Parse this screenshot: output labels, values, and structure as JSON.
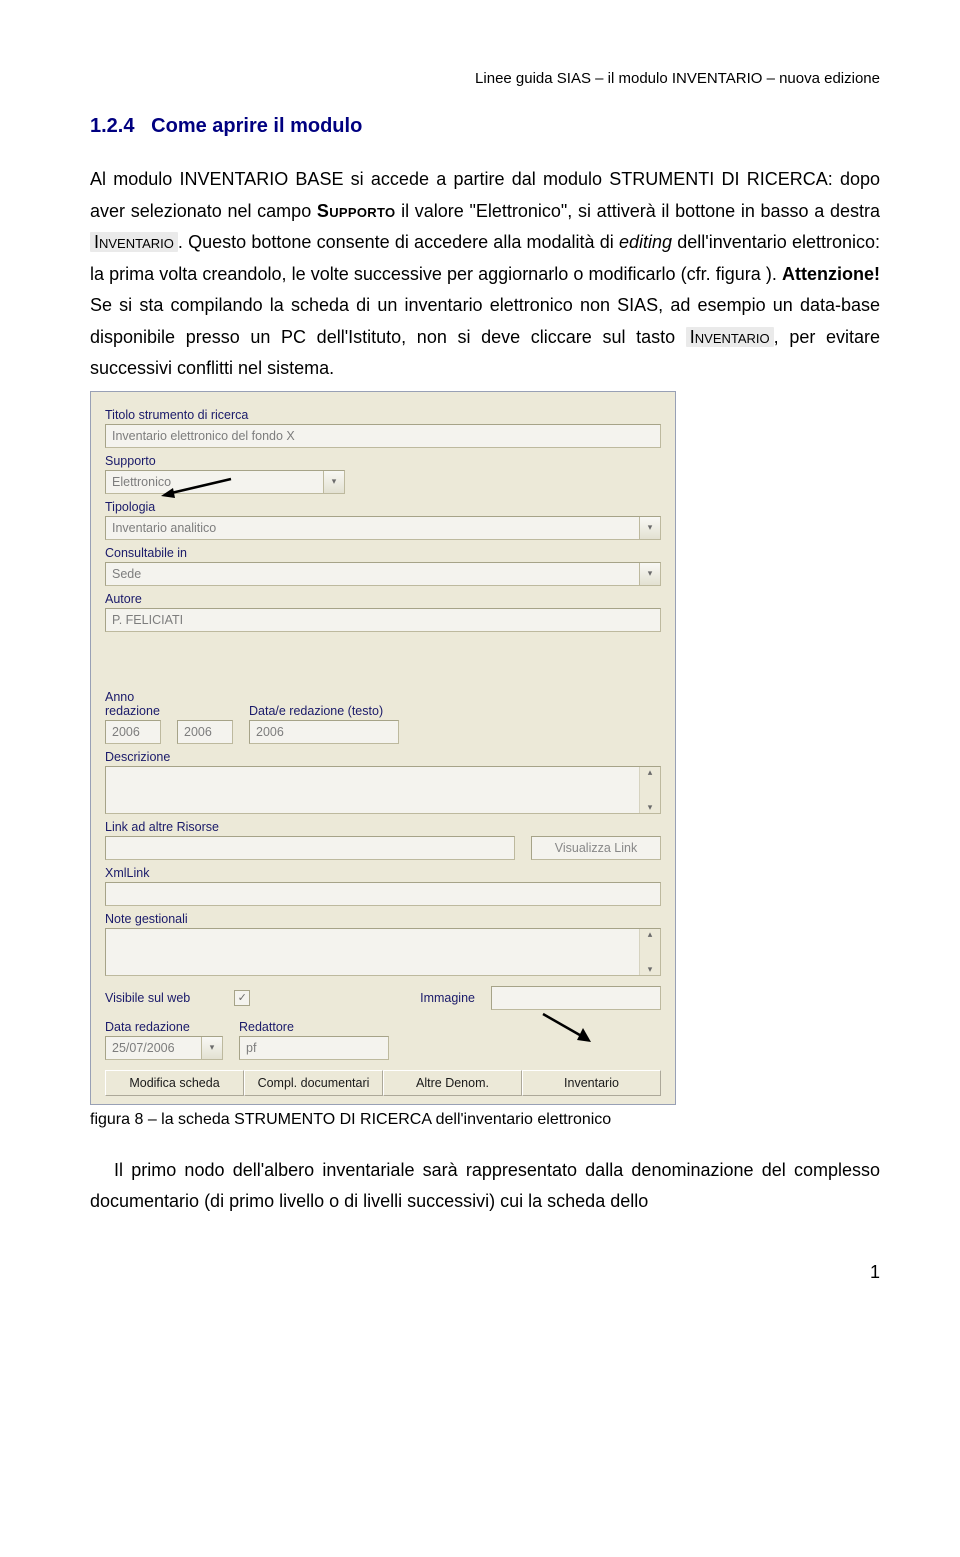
{
  "header": "Linee guida SIAS – il modulo INVENTARIO – nuova edizione",
  "section_number": "1.2.4",
  "section_title": "Come aprire il modulo",
  "p1a": "Al modulo INVENTARIO BASE si accede a partire dal modulo STRUMENTI DI RICERCA: dopo aver selezionato nel campo ",
  "p1_supporto": "Supporto",
  "p1b": " il valore \"Elettronico\", si attiverà il bottone in basso a destra ",
  "p1_btn1": "Inventario",
  "p1c": ". Questo bottone consente di accedere alla modalità di ",
  "p1_editing": "editing",
  "p1d": " dell'inventario elettronico: la prima volta creandolo, le volte successive per aggiornarlo o modificarlo (cfr. figura ). ",
  "p1_att": "Attenzione!",
  "p1e": " Se si sta compilando la scheda di un inventario elettronico non SIAS, ad esempio un data-base disponibile presso un PC dell'Istituto, non si deve cliccare sul tasto ",
  "p1_btn2": "Inventario",
  "p1f": ", per evitare successivi conflitti nel sistema.",
  "form": {
    "labels": {
      "titolo": "Titolo strumento di ricerca",
      "supporto": "Supporto",
      "tipologia": "Tipologia",
      "consultabile": "Consultabile in",
      "autore": "Autore",
      "anno": "Anno redazione",
      "datae": "Data/e redazione (testo)",
      "descrizione": "Descrizione",
      "link": "Link ad altre Risorse",
      "xml": "XmlLink",
      "note": "Note gestionali",
      "visibile": "Visibile sul web",
      "immagine": "Immagine",
      "datared": "Data redazione",
      "redattore": "Redattore"
    },
    "values": {
      "titolo": "Inventario elettronico del fondo X",
      "supporto": "Elettronico",
      "tipologia": "Inventario analitico",
      "consultabile": "Sede",
      "autore": "P. FELICIATI",
      "anno1": "2006",
      "anno2": "2006",
      "datae": "2006",
      "visualizza": "Visualizza Link",
      "datared": "25/07/2006",
      "redattore": "pf"
    },
    "buttons": {
      "b1": "Modifica scheda",
      "b2": "Compl. documentari",
      "b3": "Altre Denom.",
      "b4": "Inventario"
    }
  },
  "fig_caption": "figura 8 – la scheda STRUMENTO DI RICERCA dell'inventario elettronico",
  "p2": "Il primo nodo dell'albero inventariale sarà rappresentato dalla denominazione del complesso documentario (di primo livello o di livelli successivi) cui la scheda dello",
  "page_num": "1"
}
